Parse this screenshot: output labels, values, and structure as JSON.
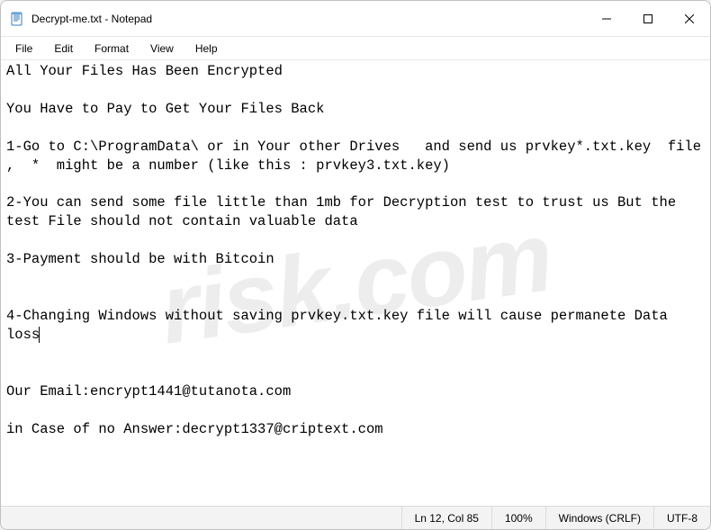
{
  "titlebar": {
    "title": "Decrypt-me.txt - Notepad"
  },
  "menubar": {
    "items": [
      "File",
      "Edit",
      "Format",
      "View",
      "Help"
    ]
  },
  "content": {
    "text": "All Your Files Has Been Encrypted\n\nYou Have to Pay to Get Your Files Back\n\n1-Go to C:\\ProgramData\\ or in Your other Drives   and send us prvkey*.txt.key  file ,  *  might be a number (like this : prvkey3.txt.key)\n\n2-You can send some file little than 1mb for Decryption test to trust us But the test File should not contain valuable data\n\n3-Payment should be with Bitcoin\n\n\n4-Changing Windows without saving prvkey.txt.key file will cause permanete Data loss",
    "text_tail": "\n\n\nOur Email:encrypt1441@tutanota.com\n\nin Case of no Answer:decrypt1337@criptext.com"
  },
  "statusbar": {
    "position": "Ln 12, Col 85",
    "zoom": "100%",
    "line_ending": "Windows (CRLF)",
    "encoding": "UTF-8"
  },
  "watermark": {
    "text": "risk.com"
  }
}
